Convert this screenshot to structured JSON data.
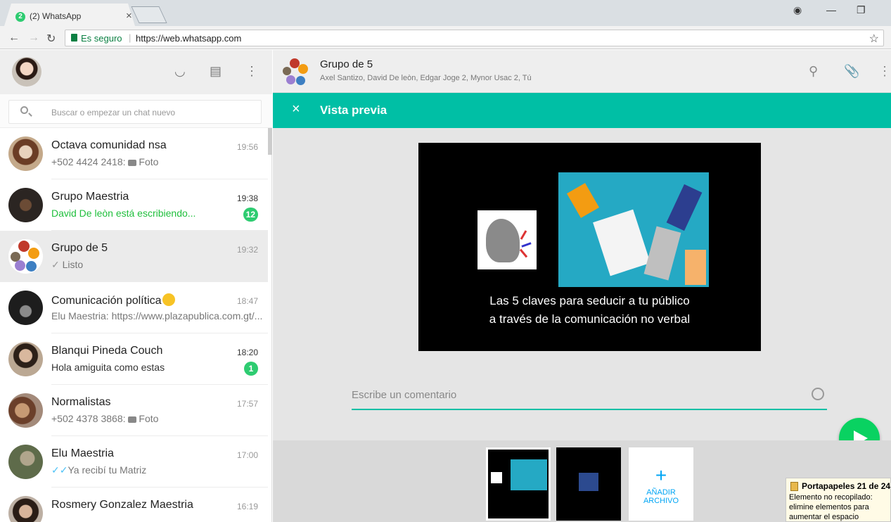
{
  "browser": {
    "tab_badge": "2",
    "tab_title": "(2) WhatsApp",
    "tab_close": "×",
    "secure_label": "Es seguro",
    "separator": "|",
    "url": "https://web.whatsapp.com"
  },
  "search": {
    "placeholder": "Buscar o empezar un chat nuevo"
  },
  "chats": [
    {
      "name": "Octava comunidad nsa",
      "time": "19:56",
      "message": "+502 4424 2418: ",
      "attachment": "Foto"
    },
    {
      "name": "Grupo Maestria",
      "time": "19:38",
      "message": "David De leòn está escribiendo...",
      "unread": "12"
    },
    {
      "name": "Grupo de 5",
      "time": "19:32",
      "message": "Listo"
    },
    {
      "name": "Comunicación política",
      "time": "18:47",
      "message": "Elu Maestria: https://www.plazapublica.com.gt/..."
    },
    {
      "name": "Blanqui Pineda Couch",
      "time": "18:20",
      "message": "Hola amiguita como estas",
      "unread": "1"
    },
    {
      "name": "Normalistas",
      "time": "17:57",
      "message": "+502 4378 3868: ",
      "attachment": "Foto"
    },
    {
      "name": "Elu Maestria",
      "time": "17:00",
      "message": "Ya recibí tu Matriz"
    },
    {
      "name": "Rosmery Gonzalez Maestria",
      "time": "16:19",
      "message": ""
    }
  ],
  "conversation": {
    "title": "Grupo de 5",
    "participants": "Axel Santizo, David De leòn, Edgar Joge 2, Mynor Usac 2, Tú"
  },
  "preview": {
    "close": "×",
    "title": "Vista previa",
    "slide_line1": "Las 5 claves para seducir a tu público",
    "slide_line2": "a través de la comunicación no verbal",
    "comment_placeholder": "Escribe un comentario",
    "add_plus": "+",
    "add_label_1": "AÑADIR",
    "add_label_2": "ARCHIVO"
  },
  "clipboard": {
    "title": "Portapapeles 21 de 24",
    "body": "Elemento no recopilado: elimine elementos para aumentar el espacio disponible"
  },
  "colors": {
    "accent": "#00bfa5",
    "send": "#09d261",
    "unread": "#2ecc71",
    "typing": "#1fbf3c"
  }
}
